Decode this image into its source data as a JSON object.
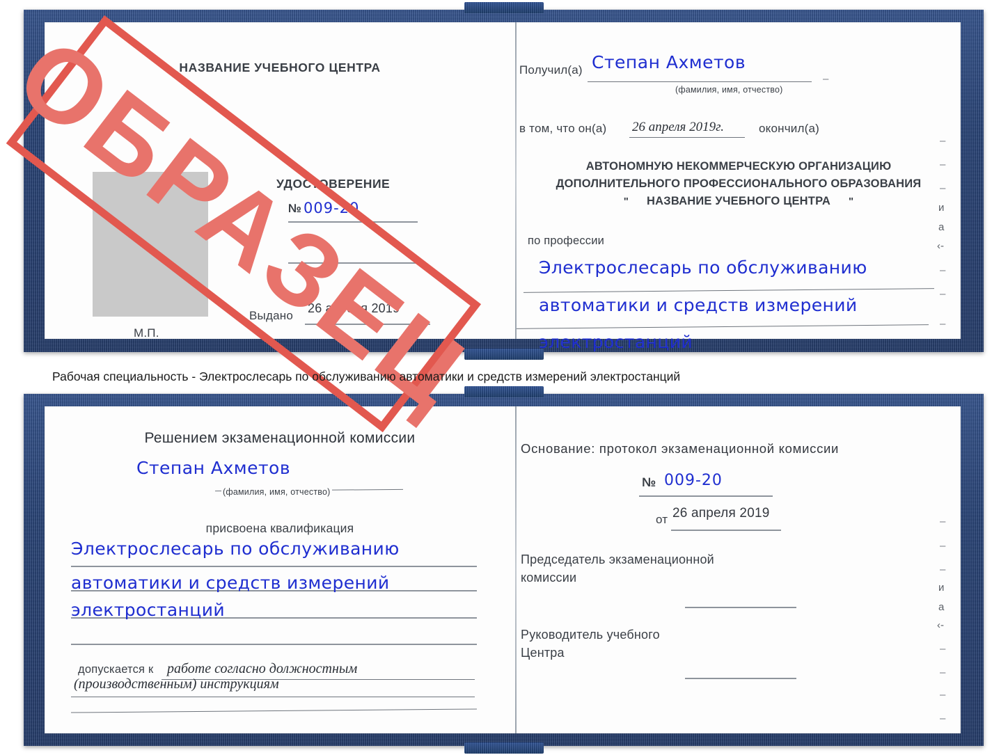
{
  "caption": {
    "text": "Рабочая специальность - Электрослесарь по обслуживанию автоматики и средств измерений электростанций"
  },
  "watermark": {
    "label": "ОБРАЗЕЦ",
    "color": "#e8736b",
    "border_color": "#e2584f"
  },
  "colors": {
    "cover_blue": "#1e3c75",
    "ink_blue": "#1f2ed0",
    "printed_gray": "#3a3f46",
    "rule_gray": "#8e949c",
    "photo_gray": "#c9c9c9"
  },
  "certificate_top": {
    "left_page": {
      "center_name": "НАЗВАНИЕ УЧЕБНОГО ЦЕНТРА",
      "doc_type": "УДОСТОВЕРЕНИЕ",
      "number_label": "№",
      "number_value": "009-20",
      "issued_label": "Выдано",
      "issued_date": "26 апреля 2019",
      "seal_label": "М.П."
    },
    "right_page": {
      "received_label": "Получил(а)",
      "received_name": "Степан Ахметов",
      "name_hint": "(фамилия, имя, отчество)",
      "that_he_label": "в том, что он(а)",
      "finish_date": "26 апреля 2019г.",
      "finished_label": "окончил(а)",
      "org_line1": "АВТОНОМНУЮ НЕКОММЕРЧЕСКУЮ ОРГАНИЗАЦИЮ",
      "org_line2": "ДОПОЛНИТЕЛЬНОГО ПРОФЕССИОНАЛЬНОГО ОБРАЗОВАНИЯ",
      "org_quote_open": "\"",
      "org_line3": "НАЗВАНИЕ УЧЕБНОГО ЦЕНТРА",
      "org_quote_close": "\"",
      "profession_label": "по профессии",
      "profession_line1": "Электрослесарь по обслуживанию",
      "profession_line2": "автоматики и средств измерений",
      "profession_line3": "электростанций",
      "margin_fragments": [
        "–",
        "–",
        "–",
        "и",
        "а",
        "‹-",
        "–",
        "–",
        "–"
      ]
    }
  },
  "certificate_bottom": {
    "left_page": {
      "decision_label": "Решением экзаменационной комиссии",
      "name": "Степан Ахметов",
      "name_hint": "(фамилия, имя, отчество)",
      "qualification_label": "присвоена квалификация",
      "qualification_line1": "Электрослесарь по обслуживанию",
      "qualification_line2": "автоматики и средств измерений",
      "qualification_line3": "электростанций",
      "admitted_label": "допускается к",
      "admitted_line1": "работе согласно должностным",
      "admitted_line2": "(производственным) инструкциям"
    },
    "right_page": {
      "basis_label": "Основание: протокол экзаменационной комиссии",
      "number_label": "№",
      "number_value": "009-20",
      "from_label": "от",
      "from_date": "26 апреля 2019",
      "chairman_line1": "Председатель экзаменационной",
      "chairman_line2": "комиссии",
      "head_line1": "Руководитель учебного",
      "head_line2": "Центра",
      "margin_fragments": [
        "–",
        "–",
        "–",
        "и",
        "а",
        "‹-",
        "–",
        "–",
        "–",
        "–"
      ]
    }
  }
}
